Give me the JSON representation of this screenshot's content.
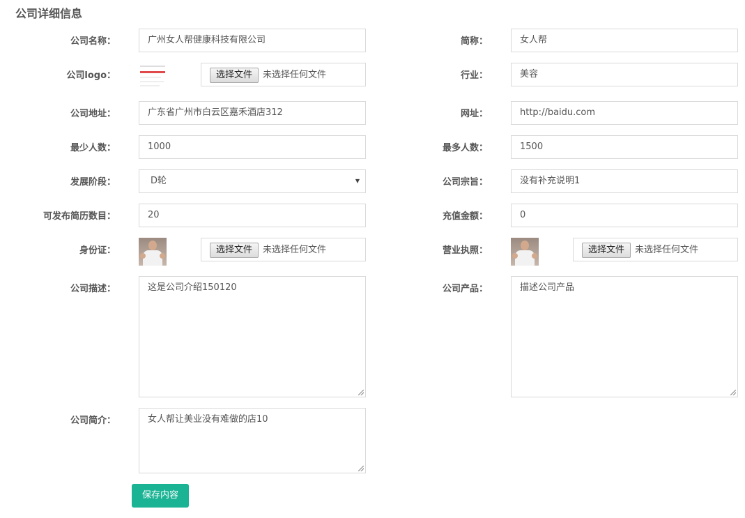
{
  "page": {
    "title": "公司详细信息"
  },
  "form": {
    "name": {
      "label": "公司名称：",
      "value": "广州女人帮健康科技有限公司"
    },
    "short_name": {
      "label": "简称：",
      "value": "女人帮"
    },
    "logo": {
      "label": "公司logo：",
      "button": "选择文件",
      "status": "未选择任何文件"
    },
    "industry": {
      "label": "行业：",
      "value": "美容"
    },
    "address": {
      "label": "公司地址：",
      "value": "广东省广州市白云区嘉禾酒店312"
    },
    "website": {
      "label": "网址：",
      "value": "http://baidu.com"
    },
    "min_staff": {
      "label": "最少人数：",
      "value": "1000"
    },
    "max_staff": {
      "label": "最多人数：",
      "value": "1500"
    },
    "stage": {
      "label": "发展阶段：",
      "value": "D轮"
    },
    "purpose": {
      "label": "公司宗旨：",
      "value": "没有补充说明1"
    },
    "resume_quota": {
      "label": "可发布简历数目：",
      "value": "20"
    },
    "recharge": {
      "label": "充值金额：",
      "value": "0"
    },
    "id_card": {
      "label": "身份证：",
      "button": "选择文件",
      "status": "未选择任何文件"
    },
    "license": {
      "label": "营业执照：",
      "button": "选择文件",
      "status": "未选择任何文件"
    },
    "description": {
      "label": "公司描述：",
      "value": "这是公司介绍150120"
    },
    "products": {
      "label": "公司产品：",
      "value": "描述公司产品"
    },
    "intro": {
      "label": "公司简介：",
      "value": "女人帮让美业没有难做的店10"
    }
  },
  "actions": {
    "save_label": "保存内容"
  },
  "colors": {
    "accent": "#1ab394",
    "border": "#d9d9d9",
    "text": "#555555"
  }
}
